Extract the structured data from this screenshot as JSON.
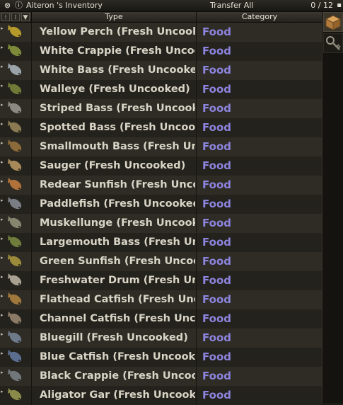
{
  "window": {
    "title": "Aiteron 's Inventory",
    "transfer_all": "Transfer All",
    "weight": "0 / 12"
  },
  "columns": {
    "type": "Type",
    "category": "Category"
  },
  "items": [
    {
      "name": "Yellow Perch (Fresh Uncooked)",
      "category": "Food",
      "icon": "fish-icon",
      "color": "#b69a2c"
    },
    {
      "name": "White Crappie (Fresh Uncooked)",
      "category": "Food",
      "icon": "fish-icon",
      "color": "#7c8a3a"
    },
    {
      "name": "White Bass (Fresh Uncooked)",
      "category": "Food",
      "icon": "fish-icon",
      "color": "#9aa4a8"
    },
    {
      "name": "Walleye (Fresh Uncooked)",
      "category": "Food",
      "icon": "fish-icon",
      "color": "#6f7a36"
    },
    {
      "name": "Striped Bass (Fresh Uncooked)",
      "category": "Food",
      "icon": "fish-icon",
      "color": "#8c8a80"
    },
    {
      "name": "Spotted Bass (Fresh Uncooked)",
      "category": "Food",
      "icon": "fish-icon",
      "color": "#8a7a52"
    },
    {
      "name": "Smallmouth Bass (Fresh Uncooked)",
      "category": "Food",
      "icon": "fish-icon",
      "color": "#8c6a3a"
    },
    {
      "name": "Sauger (Fresh Uncooked)",
      "category": "Food",
      "icon": "fish-icon",
      "color": "#a88a5a"
    },
    {
      "name": "Redear Sunfish (Fresh Uncooked)",
      "category": "Food",
      "icon": "fish-icon",
      "color": "#b0723a"
    },
    {
      "name": "Paddlefish (Fresh Uncooked)",
      "category": "Food",
      "icon": "fish-icon",
      "color": "#7a7e84"
    },
    {
      "name": "Muskellunge (Fresh Uncooked)",
      "category": "Food",
      "icon": "fish-icon",
      "color": "#86866e"
    },
    {
      "name": "Largemouth Bass (Fresh Uncooked)",
      "category": "Food",
      "icon": "fish-icon",
      "color": "#6e7c3c"
    },
    {
      "name": "Green Sunfish (Fresh Uncooked)",
      "category": "Food",
      "icon": "fish-icon",
      "color": "#9a8a3a"
    },
    {
      "name": "Freshwater Drum (Fresh Uncooked)",
      "category": "Food",
      "icon": "fish-icon",
      "color": "#a8a090"
    },
    {
      "name": "Flathead Catfish (Fresh Uncooked)",
      "category": "Food",
      "icon": "fish-icon",
      "color": "#a0783c"
    },
    {
      "name": "Channel Catfish (Fresh Uncooked)",
      "category": "Food",
      "icon": "fish-icon",
      "color": "#8a7a66"
    },
    {
      "name": "Bluegill (Fresh Uncooked)",
      "category": "Food",
      "icon": "fish-icon",
      "color": "#6e7a8a"
    },
    {
      "name": "Blue Catfish (Fresh Uncooked)",
      "category": "Food",
      "icon": "fish-icon",
      "color": "#5c6e90"
    },
    {
      "name": "Black Crappie (Fresh Uncooked)",
      "category": "Food",
      "icon": "fish-icon",
      "color": "#70767a"
    },
    {
      "name": "Aligator Gar (Fresh Uncooked)",
      "category": "Food",
      "icon": "fish-icon",
      "color": "#8a8a4a"
    }
  ]
}
